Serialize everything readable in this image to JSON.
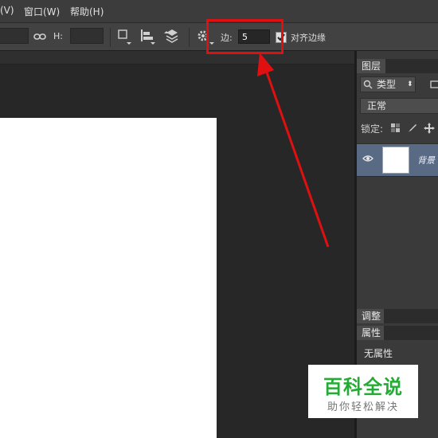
{
  "menubar": {
    "items": [
      "(V)",
      "窗口(W)",
      "帮助(H)"
    ]
  },
  "options": {
    "h_label": "H:",
    "edge_label": "边:",
    "edge_value": "5",
    "align_edges_label": "对齐边缘",
    "align_edges_checked": true
  },
  "panels": {
    "layers": {
      "tab": "图层",
      "filter": "类型",
      "blend_mode": "正常",
      "lock_label": "锁定:",
      "layer_name": "背景"
    },
    "adjustments_tab": "调整",
    "properties": {
      "tab": "属性",
      "content": "无属性"
    }
  },
  "watermark": {
    "title": "百科全说",
    "subtitle": "助你轻松解决"
  },
  "colors": {
    "annotation": "#e01010",
    "watermark_green": "#25ab35",
    "selected_layer": "#596a84"
  }
}
